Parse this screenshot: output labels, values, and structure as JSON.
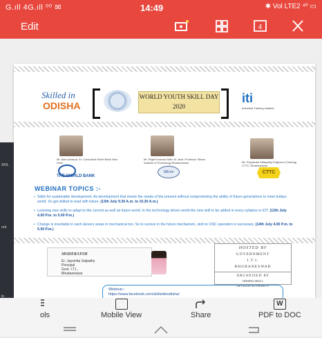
{
  "status_bar": {
    "left": "G.ıll 4G.ıll ⁰⁰ ✉",
    "time": "14:49",
    "right": "✱ Vol LTE2 ⁴⁰ ▭"
  },
  "app_bar": {
    "edit_label": "Edit",
    "icons": [
      "screenshot-icon",
      "grid-icon",
      "page-count-icon",
      "close-icon"
    ],
    "page_count": "4"
  },
  "document": {
    "skilled_logo": "Skilled in ODISHA",
    "banner": "WORLD YOUTH SKILL DAY 2020",
    "iti_logo": "iti",
    "iti_caption": "Industrial Training Institute",
    "people": [
      {
        "caption": "Mr. Alok Acharya, Sr. Consultant World Bank New Delhi"
      },
      {
        "caption": "Mr. Rajat Krushna Sahu Sr. Asst. Professor Silicon Institute of Technology Bhubaneswar"
      },
      {
        "caption": "Mr. Priyabrata Satapathy Engineer (Training) CTTC, Bhubaneswar"
      }
    ],
    "world_bank": "THE WORLD BANK",
    "sibcon": "Silicon",
    "cttc": "CTTC",
    "topics_title": "WEBINAR TOPICS :-",
    "bullets": [
      {
        "text": "Skills for sustainable development. As development that meets the needs of the present without compromising the ability of future generations to meet todays world. So get skilled to lead with future.",
        "bold": "(13th July 9.30 A.m. to 10.30 A.m.)"
      },
      {
        "text": "Learning new skills to adapt to the current as well as future world. In the technology driven world the new skill to be added in every syllabus is IOT.",
        "bold": "(13th July 4.00 P.m. to 5.00 P.m.)"
      },
      {
        "text": "Change is inevitable in each &every areas in mechanical too. So to survive in the future mechanism, skill on CNC operation is necessary.",
        "bold": "(14th July 4.00 P.m. to 5.00 P.m.)"
      }
    ],
    "moderator": {
      "title": "MODERATOR",
      "name": "Er. Jaysmita Satpathy",
      "role": "Principal",
      "org": "Govt. I.T.I.,",
      "city": "Bhubaneswar"
    },
    "hosted": {
      "title": "HOSTED BY",
      "line1": "GOVERNMENT",
      "line2": "I.T.I.",
      "line3": "BHUBANESWAR",
      "organized": "ORGANIZED BY",
      "org1": "ODISHA SKILL",
      "org2": "DEVELOP AUTHORITY"
    },
    "webinar_label": "Webinar:-",
    "webinar_url": "https://www.facebook.com/skilledinodisha/"
  },
  "toolbar": {
    "items": [
      {
        "label": "ols",
        "icon": "tools-icon"
      },
      {
        "label": "Mobile View",
        "icon": "mobile-view-icon"
      },
      {
        "label": "Share",
        "icon": "share-icon"
      },
      {
        "label": "PDF to DOC",
        "icon": "word-icon"
      }
    ]
  },
  "nav_bar": {
    "icons": [
      "menu-icon",
      "home-icon",
      "back-icon"
    ]
  }
}
